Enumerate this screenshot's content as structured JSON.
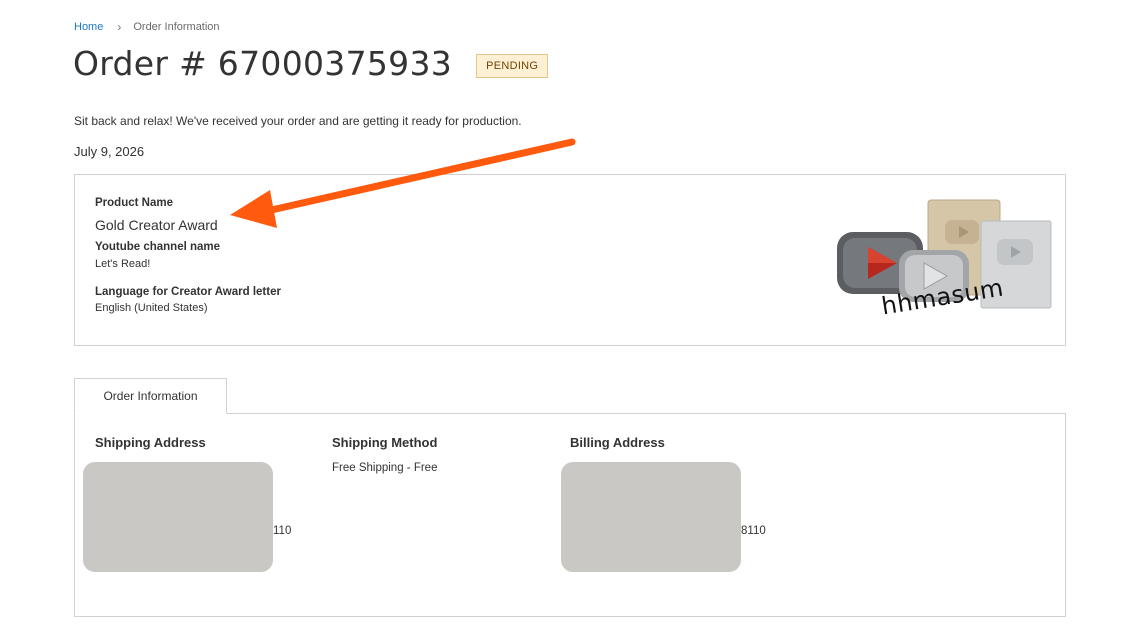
{
  "breadcrumb": {
    "home": "Home",
    "separator": "›",
    "current": "Order Information"
  },
  "order": {
    "title": "Order # 67000375933",
    "status": "PENDING",
    "message": "Sit back and relax! We've received your order and are getting it ready for production.",
    "date": "July 9, 2026"
  },
  "product": {
    "name_label": "Product Name",
    "name": "Gold Creator Award",
    "channel_label": "Youtube channel name",
    "channel": "Let's Read!",
    "language_label": "Language for Creator Award letter",
    "language": "English (United States)",
    "image_watermark": "hhmasum"
  },
  "tabs": [
    {
      "label": "Order Information",
      "active": true
    }
  ],
  "order_info": {
    "shipping_address": {
      "heading": "Shipping Address",
      "visible_tail": "110"
    },
    "shipping_method": {
      "heading": "Shipping Method",
      "value": "Free Shipping - Free"
    },
    "billing_address": {
      "heading": "Billing Address",
      "visible_tail": "8110"
    }
  },
  "colors": {
    "link": "#1979c3",
    "badge_bg": "#fdf0d5",
    "badge_border": "#e0c88a",
    "arrow": "#ff5a0d",
    "redaction": "#c9c8c4",
    "border": "#d1d1d1"
  },
  "icons": [
    "chevron-right-icon",
    "arrow-annotation",
    "play-button-award-image"
  ]
}
